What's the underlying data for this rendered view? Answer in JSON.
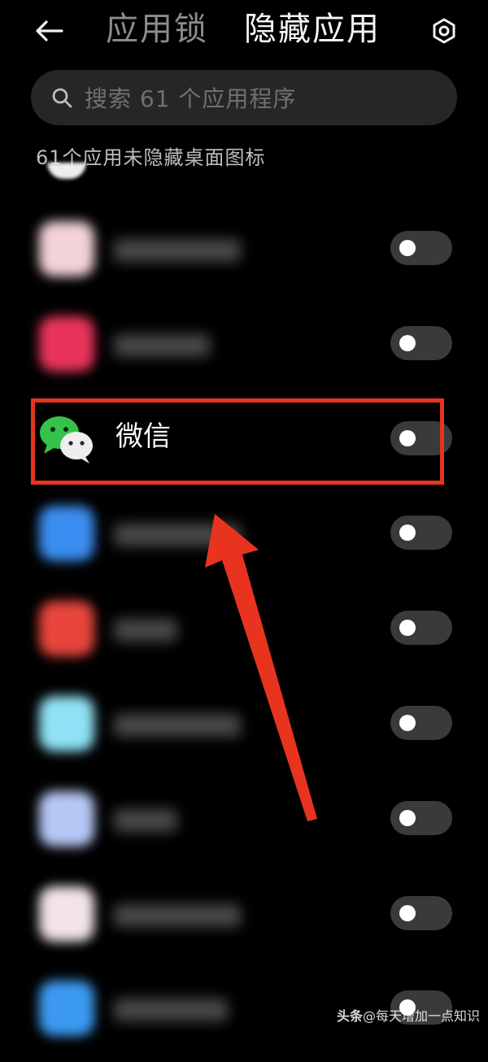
{
  "header": {
    "back_icon": "arrow-left-icon",
    "tabs": [
      {
        "label": "应用锁",
        "active": false
      },
      {
        "label": "隐藏应用",
        "active": true
      }
    ],
    "settings_icon": "gear-hexagon-icon"
  },
  "search": {
    "icon": "search-icon",
    "placeholder": "搜索 61 个应用程序",
    "value": ""
  },
  "section": {
    "label": "61个应用未隐藏桌面图标"
  },
  "apps": [
    {
      "name": "",
      "blurred": true,
      "icon_color": "#f3d3d8",
      "hidden": false
    },
    {
      "name": "",
      "blurred": true,
      "icon_color": "#e8345a",
      "hidden": false
    },
    {
      "name": "微信",
      "blurred": false,
      "icon_color": "#36c24a",
      "hidden": false
    },
    {
      "name": "",
      "blurred": true,
      "icon_color": "#3a8df0",
      "hidden": false
    },
    {
      "name": "",
      "blurred": true,
      "icon_color": "#e8453c",
      "hidden": false
    },
    {
      "name": "",
      "blurred": true,
      "icon_color": "#8fe2f5",
      "hidden": false
    },
    {
      "name": "",
      "blurred": true,
      "icon_color": "#b7c8f7",
      "hidden": false
    },
    {
      "name": "",
      "blurred": true,
      "icon_color": "#f2e4ea",
      "hidden": false
    },
    {
      "name": "",
      "blurred": true,
      "icon_color": "#3c9af2",
      "hidden": false
    }
  ],
  "annotation": {
    "highlight_color": "#e8331f",
    "target": "微信"
  },
  "watermark": {
    "brand": "头条",
    "handle": "@每天增加一点知识"
  },
  "colors": {
    "background": "#000000",
    "search_bg": "#262626",
    "toggle_off": "#3a3a3a",
    "accent_annotation": "#e8331f"
  }
}
